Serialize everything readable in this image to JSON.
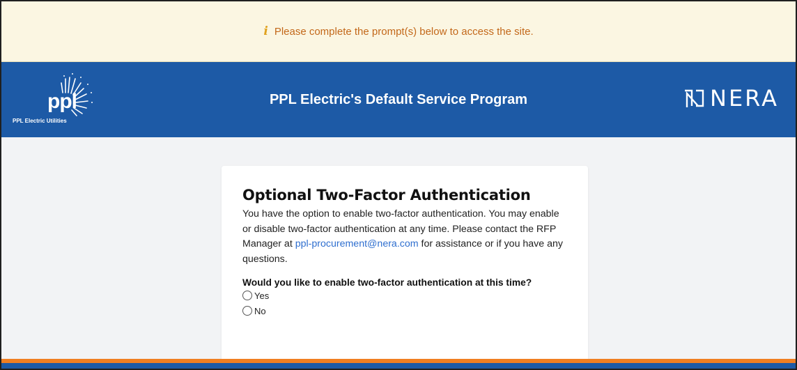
{
  "notice": {
    "icon": "info-icon",
    "text": "Please complete the prompt(s) below to access the site."
  },
  "header": {
    "title": "PPL Electric's Default Service Program",
    "left_logo": {
      "word": "ppl",
      "subtitle": "PPL Electric Utilities"
    },
    "right_logo": {
      "word": "NERA"
    }
  },
  "card": {
    "title": "Optional Two-Factor Authentication",
    "desc_before_link": "You have the option to enable two-factor authentication. You may enable or disable two-factor authentication at any time. Please contact the RFP Manager at ",
    "link_text": "ppl-procurement@nera.com",
    "desc_after_link": " for assistance or if you have any questions.",
    "question": "Would you like to enable two-factor authentication at this time?",
    "options": [
      "Yes",
      "No"
    ]
  },
  "colors": {
    "notice_bg": "#fbf6e2",
    "notice_text": "#c3681a",
    "header_blue": "#1d5aa6",
    "footer_orange": "#f07f22",
    "link": "#2f6fcf"
  }
}
